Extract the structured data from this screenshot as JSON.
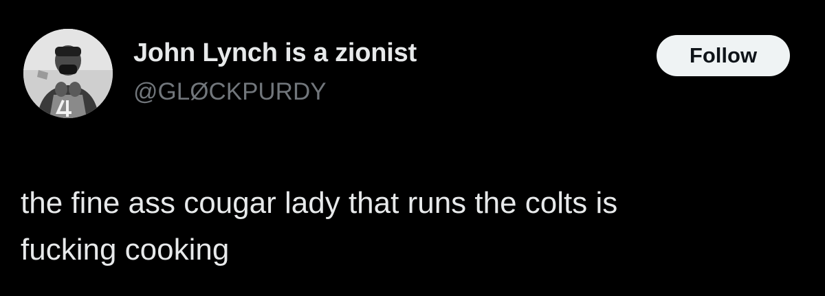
{
  "user": {
    "display_name": "John Lynch is a zionist",
    "handle": "@GLØCKPURDY"
  },
  "follow_button": {
    "label": "Follow"
  },
  "tweet": {
    "text_line_1": "the fine ass cougar lady that runs the colts is",
    "text_line_2": "fucking cooking"
  },
  "colors": {
    "background": "#000000",
    "primary_text": "#e7e9ea",
    "secondary_text": "#71767b",
    "button_background": "#eff3f4",
    "button_text": "#0f1419"
  },
  "icons": {
    "avatar": "user-avatar-photo"
  }
}
